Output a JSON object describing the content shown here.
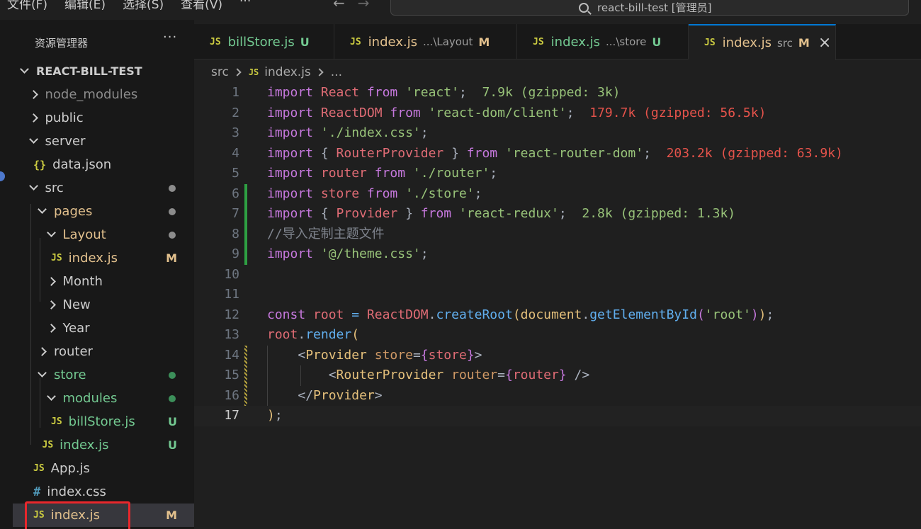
{
  "titlebar": {
    "menu": [
      "文件(F)",
      "编辑(E)",
      "选择(S)",
      "查看(V)",
      "···"
    ],
    "search_text": "react-bill-test [管理员]"
  },
  "explorer": {
    "title": "资源管理器",
    "more": "···",
    "root": "REACT-BILL-TEST",
    "items": [
      {
        "label": "node_modules",
        "type": "folder",
        "state": "collapsed",
        "depth": 1,
        "dim": true
      },
      {
        "label": "public",
        "type": "folder",
        "state": "collapsed",
        "depth": 1
      },
      {
        "label": "server",
        "type": "folder",
        "state": "expanded",
        "depth": 1
      },
      {
        "label": "data.json",
        "type": "json",
        "depth": 2
      },
      {
        "label": "src",
        "type": "folder",
        "state": "expanded",
        "depth": 1,
        "dot": "#8c8c8c"
      },
      {
        "label": "pages",
        "type": "folder",
        "state": "expanded",
        "depth": 2,
        "dot": "#8c8c8c",
        "color": "#e2c08d"
      },
      {
        "label": "Layout",
        "type": "folder",
        "state": "expanded",
        "depth": 3,
        "dot": "#8c8c8c",
        "color": "#e2c08d"
      },
      {
        "label": "index.js",
        "type": "js",
        "depth": 4,
        "badge": "M",
        "color": "#e2c08d"
      },
      {
        "label": "Month",
        "type": "folder",
        "state": "collapsed",
        "depth": 3
      },
      {
        "label": "New",
        "type": "folder",
        "state": "collapsed",
        "depth": 3
      },
      {
        "label": "Year",
        "type": "folder",
        "state": "collapsed",
        "depth": 3
      },
      {
        "label": "router",
        "type": "folder",
        "state": "collapsed",
        "depth": 2
      },
      {
        "label": "store",
        "type": "folder",
        "state": "expanded",
        "depth": 2,
        "dot": "#3c8f5a",
        "color": "#73c991"
      },
      {
        "label": "modules",
        "type": "folder",
        "state": "expanded",
        "depth": 3,
        "dot": "#3c8f5a",
        "color": "#73c991"
      },
      {
        "label": "billStore.js",
        "type": "js",
        "depth": 4,
        "badge": "U",
        "color": "#73c991"
      },
      {
        "label": "index.js",
        "type": "js",
        "depth": 3,
        "badge": "U",
        "color": "#73c991"
      },
      {
        "label": "App.js",
        "type": "js",
        "depth": 2
      },
      {
        "label": "index.css",
        "type": "css",
        "depth": 2
      },
      {
        "label": "index.js",
        "type": "js",
        "depth": 2,
        "badge": "M",
        "color": "#e2c08d",
        "selected": true
      }
    ]
  },
  "tabs": [
    {
      "name": "billStore.js",
      "desc": "",
      "status": "U",
      "active": false
    },
    {
      "name": "index.js",
      "desc": "...\\Layout",
      "status": "M",
      "active": false
    },
    {
      "name": "index.js",
      "desc": "...\\store",
      "status": "U",
      "active": false
    },
    {
      "name": "index.js",
      "desc": "src",
      "status": "M",
      "active": true
    }
  ],
  "breadcrumb": {
    "folder": "src",
    "file": "index.js",
    "more": "..."
  },
  "icons": {
    "js": "JS",
    "json": "{}",
    "css": "#",
    "close": "×"
  },
  "editor": {
    "current_line": 17,
    "lines": [
      [
        [
          "import ",
          "t-kw"
        ],
        [
          "React ",
          "t-id"
        ],
        [
          "from ",
          "t-kw"
        ],
        [
          "'react'",
          "t-str"
        ],
        [
          ";",
          "t-pn"
        ],
        [
          "  7.9k (gzipped: 3k)",
          "t-sz-ok"
        ]
      ],
      [
        [
          "import ",
          "t-kw"
        ],
        [
          "ReactDOM ",
          "t-id"
        ],
        [
          "from ",
          "t-kw"
        ],
        [
          "'react-dom/client'",
          "t-str"
        ],
        [
          ";",
          "t-pn"
        ],
        [
          "  179.7k (gzipped: 56.5k)",
          "t-sz-bad"
        ]
      ],
      [
        [
          "import ",
          "t-kw"
        ],
        [
          "'./index.css'",
          "t-str"
        ],
        [
          ";",
          "t-pn"
        ]
      ],
      [
        [
          "import ",
          "t-kw"
        ],
        [
          "{ ",
          "t-pn"
        ],
        [
          "RouterProvider ",
          "t-id"
        ],
        [
          "} ",
          "t-pn"
        ],
        [
          "from ",
          "t-kw"
        ],
        [
          "'react-router-dom'",
          "t-str"
        ],
        [
          ";",
          "t-pn"
        ],
        [
          "  203.2k (gzipped: 63.9k)",
          "t-sz-bad"
        ]
      ],
      [
        [
          "import ",
          "t-kw"
        ],
        [
          "router ",
          "t-id"
        ],
        [
          "from ",
          "t-kw"
        ],
        [
          "'./router'",
          "t-str"
        ],
        [
          ";",
          "t-pn"
        ]
      ],
      [
        [
          "import ",
          "t-kw"
        ],
        [
          "store ",
          "t-id"
        ],
        [
          "from ",
          "t-kw"
        ],
        [
          "'./store'",
          "t-str"
        ],
        [
          ";",
          "t-pn"
        ]
      ],
      [
        [
          "import ",
          "t-kw"
        ],
        [
          "{ ",
          "t-pn"
        ],
        [
          "Provider ",
          "t-id"
        ],
        [
          "} ",
          "t-pn"
        ],
        [
          "from ",
          "t-kw"
        ],
        [
          "'react-redux'",
          "t-str"
        ],
        [
          ";",
          "t-pn"
        ],
        [
          "  2.8k (gzipped: 1.3k)",
          "t-sz-ok"
        ]
      ],
      [
        [
          "//导入定制主题文件",
          "t-cm"
        ]
      ],
      [
        [
          "import ",
          "t-kw"
        ],
        [
          "'@/theme.css'",
          "t-str"
        ],
        [
          ";",
          "t-pn"
        ]
      ],
      [],
      [],
      [
        [
          "const ",
          "t-kw"
        ],
        [
          "root ",
          "t-id"
        ],
        [
          "= ",
          "t-fn"
        ],
        [
          "ReactDOM",
          "t-id"
        ],
        [
          ".",
          "t-pn"
        ],
        [
          "createRoot",
          "t-fn"
        ],
        [
          "(",
          "t-br1"
        ],
        [
          "document",
          "t-var"
        ],
        [
          ".",
          "t-pn"
        ],
        [
          "getElementById",
          "t-fn"
        ],
        [
          "(",
          "t-br2"
        ],
        [
          "'root'",
          "t-str"
        ],
        [
          ")",
          "t-br2"
        ],
        [
          ")",
          "t-br1"
        ],
        [
          ";",
          "t-pn"
        ]
      ],
      [
        [
          "root",
          "t-id"
        ],
        [
          ".",
          "t-pn"
        ],
        [
          "render",
          "t-fn"
        ],
        [
          "(",
          "t-br1"
        ]
      ],
      [
        [
          "    ",
          "t-pn"
        ],
        [
          "<",
          "t-pn"
        ],
        [
          "Provider ",
          "t-tag"
        ],
        [
          "store",
          "t-attr"
        ],
        [
          "=",
          "t-pn"
        ],
        [
          "{",
          "t-br2"
        ],
        [
          "store",
          "t-id"
        ],
        [
          "}",
          "t-br2"
        ],
        [
          ">",
          "t-pn"
        ]
      ],
      [
        [
          "        ",
          "t-pn"
        ],
        [
          "<",
          "t-pn"
        ],
        [
          "RouterProvider ",
          "t-tag"
        ],
        [
          "router",
          "t-attr"
        ],
        [
          "=",
          "t-pn"
        ],
        [
          "{",
          "t-br2"
        ],
        [
          "router",
          "t-id"
        ],
        [
          "} ",
          "t-br2"
        ],
        [
          "/>",
          "t-pn"
        ]
      ],
      [
        [
          "    ",
          "t-pn"
        ],
        [
          "</",
          "t-pn"
        ],
        [
          "Provider",
          "t-tag"
        ],
        [
          ">",
          "t-pn"
        ]
      ],
      [
        [
          ")",
          "t-br1"
        ],
        [
          ";",
          "t-pn"
        ]
      ]
    ],
    "gutter_marks": [
      {
        "from": 6,
        "to": 9,
        "kind": "added"
      },
      {
        "from": 14,
        "to": 16,
        "kind": "modified"
      }
    ]
  }
}
